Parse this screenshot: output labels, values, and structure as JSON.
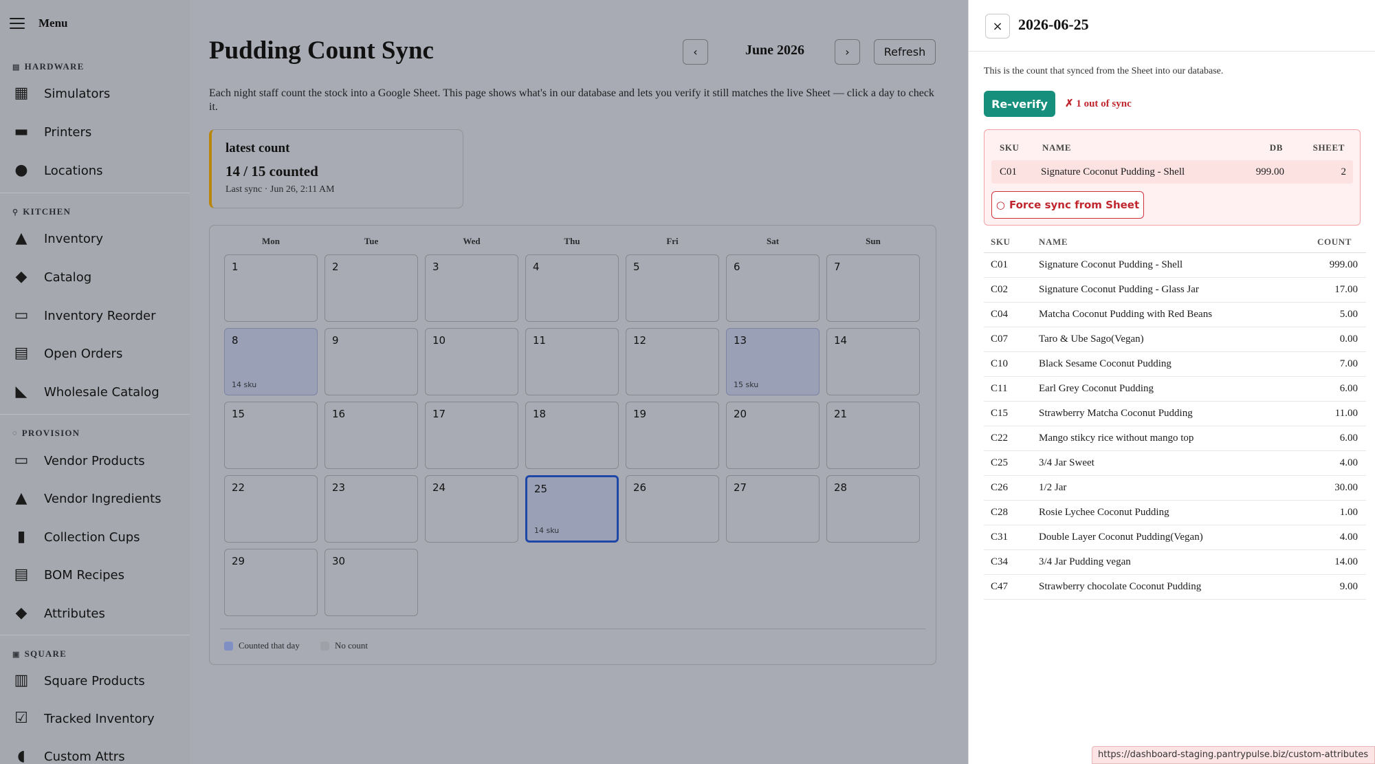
{
  "sidebar": {
    "menu_label": "Menu",
    "sections": {
      "hardware": "HARDWARE",
      "kitchen": "KITCHEN",
      "provision": "PROVISION",
      "square": "SQUARE"
    },
    "items": {
      "simulators": "Simulators",
      "printers": "Printers",
      "locations": "Locations",
      "inventory": "Inventory",
      "catalog": "Catalog",
      "inventory_reorder": "Inventory Reorder",
      "open_orders": "Open Orders",
      "wholesale_catalog": "Wholesale Catalog",
      "vendor_products": "Vendor Products",
      "vendor_ingredients": "Vendor Ingredients",
      "collection_cups": "Collection Cups",
      "bom_recipes": "BOM Recipes",
      "attributes": "Attributes",
      "square_products": "Square Products",
      "tracked_inventory": "Tracked Inventory",
      "custom_attrs": "Custom Attrs"
    }
  },
  "main": {
    "title": "Pudding Count Sync",
    "prev_label": "‹",
    "next_label": "›",
    "month": "June 2026",
    "refresh_label": "Refresh",
    "description": "Each night staff count the stock into a Google Sheet. This page shows what's in our database and lets you verify it still matches the live Sheet — click a day to check it.",
    "summary": {
      "title": "latest count",
      "count": "14 / 15 counted",
      "last_sync": "Last sync · Jun 26, 2:11 AM"
    }
  },
  "calendar": {
    "weekdays": [
      "Mon",
      "Tue",
      "Wed",
      "Thu",
      "Fri",
      "Sat",
      "Sun"
    ],
    "days": [
      {
        "n": "1"
      },
      {
        "n": "2"
      },
      {
        "n": "3"
      },
      {
        "n": "4"
      },
      {
        "n": "5"
      },
      {
        "n": "6"
      },
      {
        "n": "7"
      },
      {
        "n": "8",
        "sku": "14 sku"
      },
      {
        "n": "9"
      },
      {
        "n": "10"
      },
      {
        "n": "11"
      },
      {
        "n": "12"
      },
      {
        "n": "13",
        "sku": "15 sku"
      },
      {
        "n": "14"
      },
      {
        "n": "15"
      },
      {
        "n": "16"
      },
      {
        "n": "17"
      },
      {
        "n": "18"
      },
      {
        "n": "19"
      },
      {
        "n": "20"
      },
      {
        "n": "21"
      },
      {
        "n": "22"
      },
      {
        "n": "23"
      },
      {
        "n": "24"
      },
      {
        "n": "25",
        "sku": "14 sku"
      },
      {
        "n": "26"
      },
      {
        "n": "27"
      },
      {
        "n": "28"
      },
      {
        "n": "29"
      },
      {
        "n": "30"
      }
    ],
    "legend": {
      "counted": "Counted that day",
      "none": "No count"
    },
    "colors": {
      "counted": "#7f8fc4",
      "no_count": "#9ea1a8",
      "selected_border": "#1f48a6"
    }
  },
  "panel": {
    "close_icon": "×",
    "date": "2026-06-25",
    "note": "This is the count that synced from the Sheet into our database.",
    "reverify_label": "Re-verify",
    "sync_status": "✗ 1 out of sync",
    "mismatch": {
      "headers": {
        "sku": "SKU",
        "name": "NAME",
        "db": "DB",
        "sheet": "SHEET"
      },
      "rows": [
        {
          "sku": "C01",
          "name": "Signature Coconut Pudding - Shell",
          "db": "999.00",
          "sheet": "2"
        }
      ],
      "force_icon": "○",
      "force_label": "Force sync from Sheet"
    },
    "counts": {
      "headers": {
        "sku": "SKU",
        "name": "NAME",
        "count": "COUNT"
      },
      "rows": [
        {
          "sku": "C01",
          "name": "Signature Coconut Pudding - Shell",
          "count": "999.00"
        },
        {
          "sku": "C02",
          "name": "Signature Coconut Pudding - Glass Jar",
          "count": "17.00"
        },
        {
          "sku": "C04",
          "name": "Matcha Coconut Pudding with Red Beans",
          "count": "5.00"
        },
        {
          "sku": "C07",
          "name": "Taro & Ube Sago(Vegan)",
          "count": "0.00"
        },
        {
          "sku": "C10",
          "name": "Black Sesame Coconut Pudding",
          "count": "7.00"
        },
        {
          "sku": "C11",
          "name": "Earl Grey Coconut Pudding",
          "count": "6.00"
        },
        {
          "sku": "C15",
          "name": "Strawberry Matcha Coconut Pudding",
          "count": "11.00"
        },
        {
          "sku": "C22",
          "name": "Mango stikcy rice without mango top",
          "count": "6.00"
        },
        {
          "sku": "C25",
          "name": "3/4 Jar Sweet",
          "count": "4.00"
        },
        {
          "sku": "C26",
          "name": "1/2 Jar",
          "count": "30.00"
        },
        {
          "sku": "C28",
          "name": "Rosie Lychee Coconut Pudding",
          "count": "1.00"
        },
        {
          "sku": "C31",
          "name": "Double Layer Coconut Pudding(Vegan)",
          "count": "4.00"
        },
        {
          "sku": "C34",
          "name": "3/4 Jar Pudding vegan",
          "count": "14.00"
        },
        {
          "sku": "C47",
          "name": "Strawberry chocolate Coconut Pudding",
          "count": "9.00"
        }
      ]
    }
  },
  "status_bar": {
    "url": "https://dashboard-staging.pantrypulse.biz/custom-attributes"
  }
}
